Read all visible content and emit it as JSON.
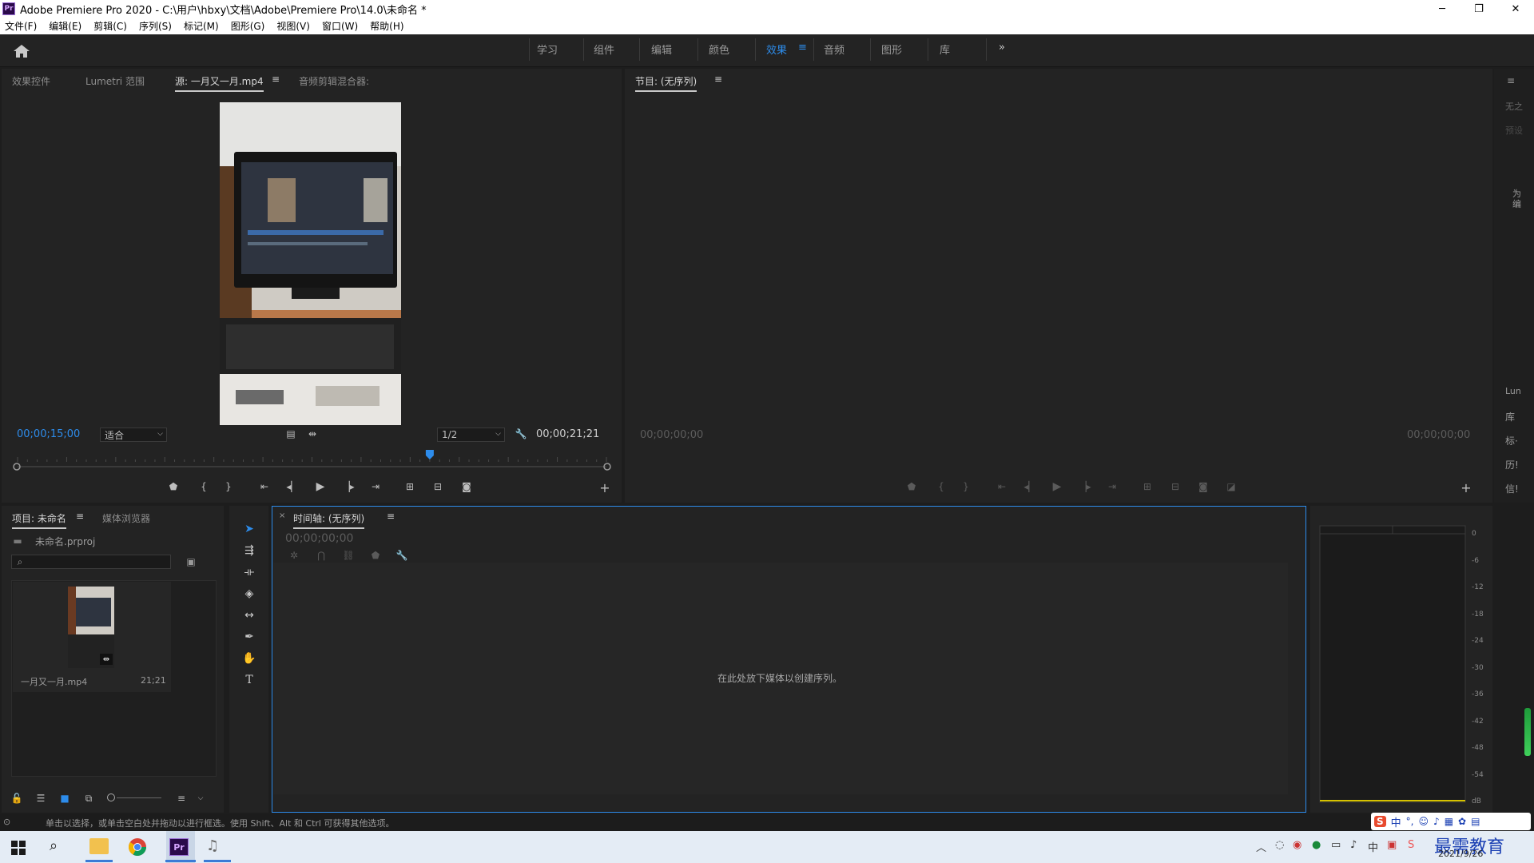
{
  "app": {
    "title": "Adobe Premiere Pro 2020 - C:\\用户\\hbxy\\文档\\Adobe\\Premiere Pro\\14.0\\未命名 *",
    "logo": "Pr"
  },
  "menu": [
    "文件(F)",
    "编辑(E)",
    "剪辑(C)",
    "序列(S)",
    "标记(M)",
    "图形(G)",
    "视图(V)",
    "窗口(W)",
    "帮助(H)"
  ],
  "workspaces": {
    "items": [
      "学习",
      "组件",
      "编辑",
      "颜色",
      "效果",
      "音频",
      "图形",
      "库"
    ],
    "active": "效果",
    "more": "»"
  },
  "source_panel": {
    "tabs": [
      "效果控件",
      "Lumetri 范围",
      "源: 一月又一月.mp4",
      "音频剪辑混合器:"
    ],
    "timecode_in": "00;00;15;00",
    "fit": "适合",
    "resolution": "1/2",
    "duration": "00;00;21;21",
    "playhead_fraction": 0.7
  },
  "program_panel": {
    "tab": "节目: (无序列)",
    "timecode_left": "00;00;00;00",
    "timecode_right": "00;00;00;00"
  },
  "project_panel": {
    "tabs": [
      "项目: 未命名",
      "媒体浏览器"
    ],
    "project_file": "未命名.prproj",
    "search_placeholder": "",
    "clip_name": "一月又一月.mp4",
    "clip_duration": "21;21"
  },
  "timeline_panel": {
    "tab": "时间轴: (无序列)",
    "timecode": "00;00;00;00",
    "empty_message": "在此处放下媒体以创建序列。"
  },
  "audio_meter": {
    "labels": [
      "0",
      "-6",
      "-12",
      "-18",
      "-24",
      "-30",
      "-36",
      "-42",
      "-48",
      "-54",
      "dB"
    ]
  },
  "right_strip": {
    "items": [
      "无之",
      "预设",
      "为编",
      "Lun",
      "库",
      "标·",
      "历!",
      "信!"
    ]
  },
  "status_bar": {
    "text": "单击以选择，或单击空白处并拖动以进行框选。使用 Shift、Alt 和 Ctrl 可获得其他选项。"
  },
  "taskbar": {
    "date": "2021/9/26",
    "ime": "中",
    "watermark": "最需教育"
  },
  "colors": {
    "accent": "#2d8ceb",
    "panel_bg": "#232323",
    "timeline_border": "#2d8ceb"
  }
}
